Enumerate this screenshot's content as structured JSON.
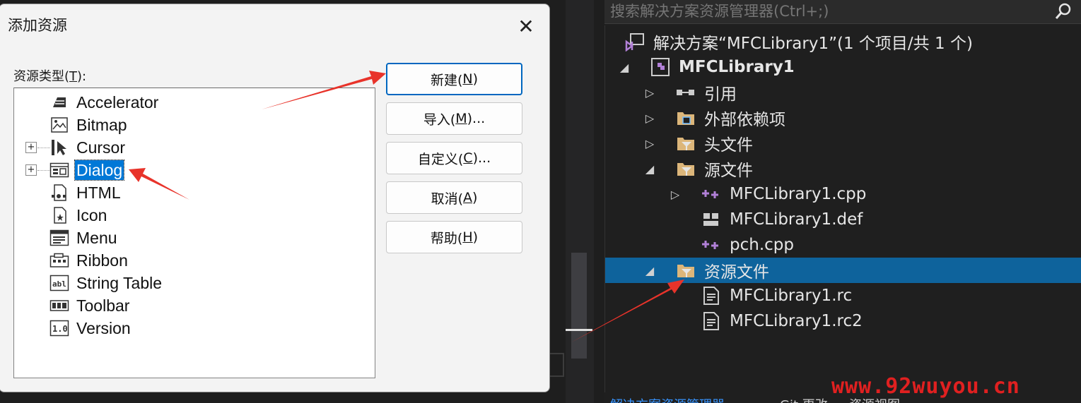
{
  "dialog": {
    "title": "添加资源",
    "close_glyph": "✕",
    "type_label": "资源类型(",
    "type_label_key": "T",
    "type_label_end": "):",
    "resource_types": [
      {
        "label": "Accelerator",
        "expandable": false,
        "selected": false,
        "icon": "accelerator-icon"
      },
      {
        "label": "Bitmap",
        "expandable": false,
        "selected": false,
        "icon": "bitmap-icon"
      },
      {
        "label": "Cursor",
        "expandable": true,
        "selected": false,
        "icon": "cursor-icon"
      },
      {
        "label": "Dialog",
        "expandable": true,
        "selected": true,
        "icon": "dialog-icon"
      },
      {
        "label": "HTML",
        "expandable": false,
        "selected": false,
        "icon": "html-icon"
      },
      {
        "label": "Icon",
        "expandable": false,
        "selected": false,
        "icon": "icon-icon"
      },
      {
        "label": "Menu",
        "expandable": false,
        "selected": false,
        "icon": "menu-icon"
      },
      {
        "label": "Ribbon",
        "expandable": false,
        "selected": false,
        "icon": "ribbon-icon"
      },
      {
        "label": "String Table",
        "expandable": false,
        "selected": false,
        "icon": "string-table-icon"
      },
      {
        "label": "Toolbar",
        "expandable": false,
        "selected": false,
        "icon": "toolbar-icon"
      },
      {
        "label": "Version",
        "expandable": false,
        "selected": false,
        "icon": "version-icon"
      }
    ],
    "buttons": {
      "new": {
        "pre": "新建(",
        "key": "N",
        "post": ")"
      },
      "import": {
        "pre": "导入(",
        "key": "M",
        "post": ")..."
      },
      "custom": {
        "pre": "自定义(",
        "key": "C",
        "post": ")..."
      },
      "cancel": {
        "pre": "取消(",
        "key": "A",
        "post": ")"
      },
      "help": {
        "pre": "帮助(",
        "key": "H",
        "post": ")"
      }
    },
    "expander_glyph": "+"
  },
  "explorer": {
    "search_placeholder": "搜索解决方案资源管理器(Ctrl+;)",
    "items": [
      {
        "label": "解决方案“MFCLibrary1”(1 个项目/共 1 个)",
        "arrow": "",
        "icon": "solution-icon",
        "bold": false,
        "selected": false
      },
      {
        "label": "MFCLibrary1",
        "arrow": "◢",
        "icon": "project-icon",
        "bold": true,
        "selected": false
      },
      {
        "label": "引用",
        "arrow": "▷",
        "icon": "references-icon",
        "bold": false,
        "selected": false
      },
      {
        "label": "外部依赖项",
        "arrow": "▷",
        "icon": "external-deps-icon",
        "bold": false,
        "selected": false
      },
      {
        "label": "头文件",
        "arrow": "▷",
        "icon": "header-folder-icon",
        "bold": false,
        "selected": false
      },
      {
        "label": "源文件",
        "arrow": "◢",
        "icon": "source-folder-icon",
        "bold": false,
        "selected": false
      },
      {
        "label": "MFCLibrary1.cpp",
        "arrow": "▷",
        "icon": "cpp-file-icon",
        "bold": false,
        "selected": false
      },
      {
        "label": "MFCLibrary1.def",
        "arrow": "",
        "icon": "def-file-icon",
        "bold": false,
        "selected": false
      },
      {
        "label": "pch.cpp",
        "arrow": "",
        "icon": "cpp-file-icon",
        "bold": false,
        "selected": false
      },
      {
        "label": "资源文件",
        "arrow": "◢",
        "icon": "resource-folder-icon",
        "bold": false,
        "selected": true
      },
      {
        "label": "MFCLibrary1.rc",
        "arrow": "",
        "icon": "rc-file-icon",
        "bold": false,
        "selected": false
      },
      {
        "label": "MFCLibrary1.rc2",
        "arrow": "",
        "icon": "rc-file-icon",
        "bold": false,
        "selected": false
      }
    ],
    "bottom_tabs": [
      "解决方案资源管理器",
      "Git 更改",
      "资源视图"
    ]
  },
  "watermark": "www.92wuyou.cn",
  "colors": {
    "selection": "#0078d7",
    "explorer_selection": "#0e639c",
    "arrow": "#e8332a",
    "accent": "#0067c0"
  }
}
